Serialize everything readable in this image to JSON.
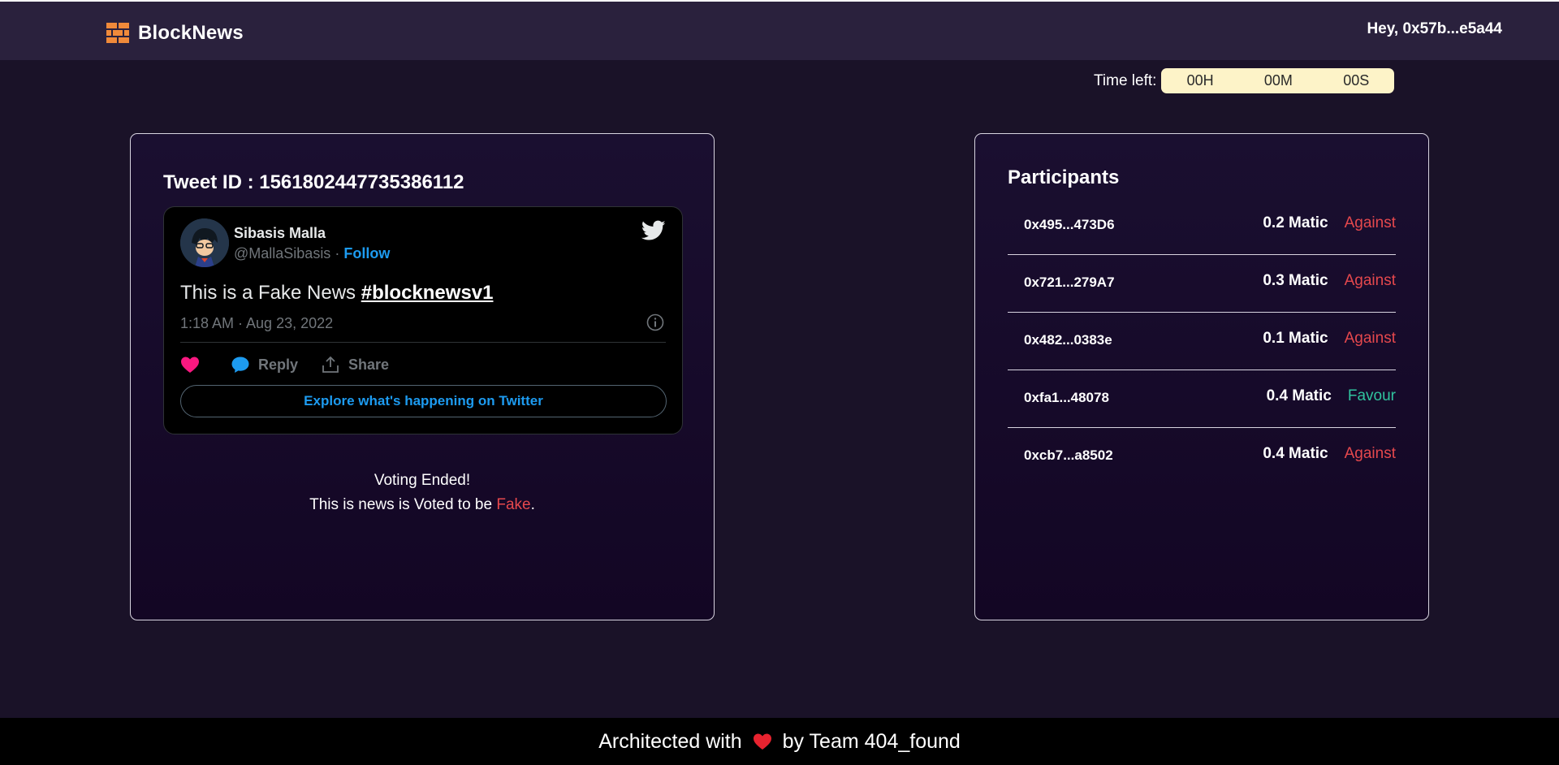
{
  "header": {
    "brand": "BlockNews",
    "greeting": "Hey, 0x57b...e5a44"
  },
  "timer": {
    "label": "Time left:",
    "hours": "00H",
    "minutes": "00M",
    "seconds": "00S"
  },
  "tweet_card": {
    "tweet_id_label": "Tweet ID : 1561802447735386112",
    "tweet": {
      "author_name": "Sibasis Malla",
      "author_handle": "@MallaSibasis",
      "separator": "·",
      "follow_label": "Follow",
      "text": "This is a Fake News ",
      "hashtag": "#blocknewsv1",
      "timestamp": "1:18 AM · Aug 23, 2022",
      "reply_label": "Reply",
      "share_label": "Share",
      "explore_label": "Explore what's happening on Twitter"
    },
    "voting_status": "Voting Ended!",
    "voting_result_prefix": "This is news is Voted to be ",
    "voting_result_value": "Fake",
    "voting_result_suffix": "."
  },
  "participants": {
    "title": "Participants",
    "items": [
      {
        "address": "0x495...473D6",
        "amount": "0.2 Matic",
        "vote": "Against"
      },
      {
        "address": "0x721...279A7",
        "amount": "0.3 Matic",
        "vote": "Against"
      },
      {
        "address": "0x482...0383e",
        "amount": "0.1 Matic",
        "vote": "Against"
      },
      {
        "address": "0xfa1...48078",
        "amount": "0.4 Matic",
        "vote": "Favour"
      },
      {
        "address": "0xcb7...a8502",
        "amount": "0.4 Matic",
        "vote": "Against"
      }
    ]
  },
  "footer": {
    "prefix": "Architected with",
    "suffix": "by Team 404_found"
  },
  "colors": {
    "against": "#e5484d",
    "favour": "#30c39e",
    "twitter_blue": "#1d9bf0",
    "timer_bg": "#fdf3c8"
  }
}
